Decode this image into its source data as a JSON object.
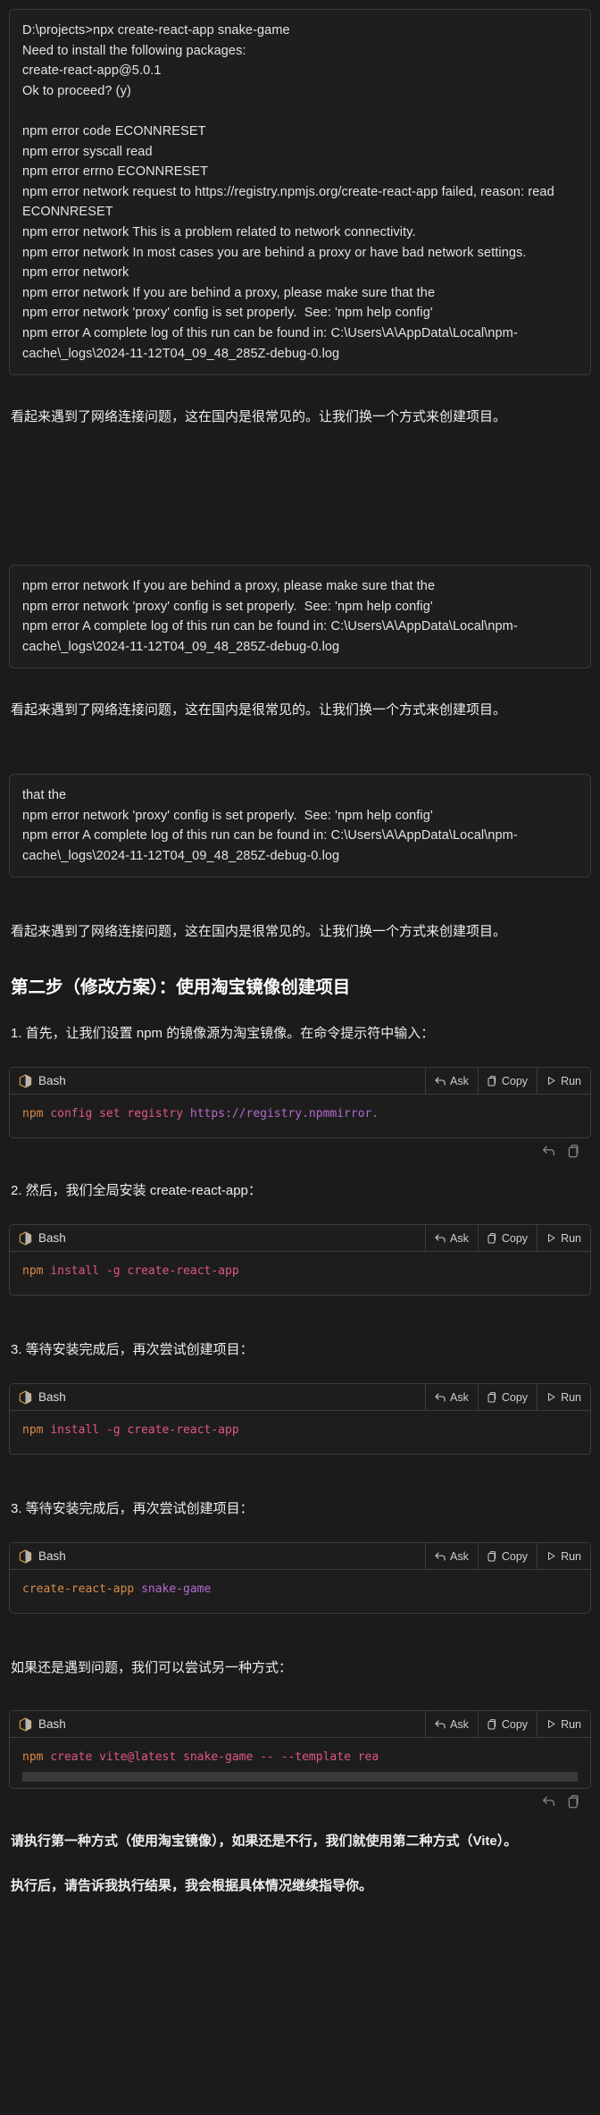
{
  "theme": {
    "bg": "#1b1b1b",
    "panel": "#1e1e1e",
    "border": "#3a3a3a",
    "text": "#e6e6e6"
  },
  "terminal_block_1": {
    "lines": [
      "D:\\projects>npx create-react-app snake-game",
      "Need to install the following packages:",
      "create-react-app@5.0.1",
      "Ok to proceed? (y)",
      "",
      "npm error code ECONNRESET",
      "npm error syscall read",
      "npm error errno ECONNRESET",
      "npm error network request to https://registry.npmjs.org/create-react-app failed, reason: read ECONNRESET",
      "npm error network This is a problem related to network connectivity.",
      "npm error network In most cases you are behind a proxy or have bad network settings.",
      "npm error network",
      "npm error network If you are behind a proxy, please make sure that the",
      "npm error network 'proxy' config is set properly.  See: 'npm help config'",
      "npm error A complete log of this run can be found in: C:\\Users\\A\\AppData\\Local\\npm-cache\\_logs\\2024-11-12T04_09_48_285Z-debug-0.log"
    ]
  },
  "terminal_block_2": {
    "lines": [
      "that the",
      "npm error network 'proxy' config is set properly.  See: 'npm help config'",
      "npm error A complete log of this run can be found in: C:\\Users\\A\\AppData\\Local\\npm-cache\\_logs\\2024-11-12T04_09_48_285Z-debug-0.log"
    ]
  },
  "intro_paragraph": "看起来遇到了网络连接问题，这在国内是很常见的。让我们换一个方式来创建项目。",
  "heading": "第二步（修改方案）：使用淘宝镜像创建项目",
  "step_1_text": "1. 首先，让我们设置 npm 的镜像源为淘宝镜像。在命令提示符中输入：",
  "step_2_text": "2. 然后，我们全局安装 create-react-app：",
  "step_3_text": "3. 等待安装完成后，再次尝试创建项目：",
  "step_3b_text": "3. 等待安装完成后，再次尝试创建项目：",
  "alt_text": "如果还是遇到问题，我们可以尝试另一种方式：",
  "closing_1": "请执行第一种方式（使用淘宝镜像），如果还是不行，我们就使用第二种方式（Vite）。",
  "closing_2": "执行后，请告诉我执行结果，我会根据具体情况继续指导你。",
  "code_block_actions": {
    "lang_label": "Bash",
    "ask_label": "Ask",
    "copy_label": "Copy",
    "run_label": "Run",
    "lang_icon": "bash-cube-icon",
    "ask_icon": "reply-arrow-icon",
    "copy_icon": "copy-icon",
    "run_icon": "play-triangle-icon"
  },
  "code_blocks": [
    {
      "id": "registry",
      "lang": "Bash",
      "code": "npm config set registry https://registry.npmmirror.",
      "tokens": [
        {
          "t": "npm",
          "c": "tok-cmd"
        },
        {
          "t": " ",
          "c": ""
        },
        {
          "t": "config",
          "c": "tok-sub"
        },
        {
          "t": " ",
          "c": ""
        },
        {
          "t": "set",
          "c": "tok-sub"
        },
        {
          "t": " ",
          "c": ""
        },
        {
          "t": "registry",
          "c": "tok-sub"
        },
        {
          "t": " ",
          "c": ""
        },
        {
          "t": "https://registry.npmmirror.",
          "c": "tok-str"
        }
      ]
    },
    {
      "id": "install-cra-1",
      "lang": "Bash",
      "code": "npm install -g create-react-app",
      "tokens": [
        {
          "t": "npm",
          "c": "tok-cmd"
        },
        {
          "t": " ",
          "c": ""
        },
        {
          "t": "install",
          "c": "tok-sub"
        },
        {
          "t": " ",
          "c": ""
        },
        {
          "t": "-g",
          "c": "tok-arg"
        },
        {
          "t": " ",
          "c": ""
        },
        {
          "t": "create-react-app",
          "c": "tok-sub"
        }
      ]
    },
    {
      "id": "install-cra-2",
      "lang": "Bash",
      "code": "npm install -g create-react-app",
      "tokens": [
        {
          "t": "npm",
          "c": "tok-cmd"
        },
        {
          "t": " ",
          "c": ""
        },
        {
          "t": "install",
          "c": "tok-sub"
        },
        {
          "t": " ",
          "c": ""
        },
        {
          "t": "-g",
          "c": "tok-arg"
        },
        {
          "t": " ",
          "c": ""
        },
        {
          "t": "create-react-app",
          "c": "tok-sub"
        }
      ]
    },
    {
      "id": "create-app",
      "lang": "Bash",
      "code": "create-react-app snake-game",
      "tokens": [
        {
          "t": "create-react-app",
          "c": "tok-cmd"
        },
        {
          "t": " ",
          "c": ""
        },
        {
          "t": "snake-game",
          "c": "tok-name"
        }
      ]
    },
    {
      "id": "vite",
      "lang": "Bash",
      "code": "npm create vite@latest snake-game -- --template rea",
      "tokens": [
        {
          "t": "npm",
          "c": "tok-cmd"
        },
        {
          "t": " ",
          "c": ""
        },
        {
          "t": "create",
          "c": "tok-sub"
        },
        {
          "t": " ",
          "c": ""
        },
        {
          "t": "vite@latest",
          "c": "tok-sub"
        },
        {
          "t": " ",
          "c": ""
        },
        {
          "t": "snake-game",
          "c": "tok-sub"
        },
        {
          "t": " ",
          "c": ""
        },
        {
          "t": "--",
          "c": "tok-arg"
        },
        {
          "t": " ",
          "c": ""
        },
        {
          "t": "--template",
          "c": "tok-arg"
        },
        {
          "t": " ",
          "c": ""
        },
        {
          "t": "rea",
          "c": "tok-sub"
        }
      ]
    }
  ]
}
